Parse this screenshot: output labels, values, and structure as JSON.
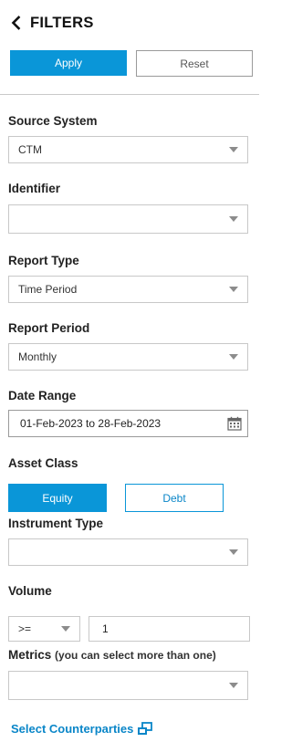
{
  "header": {
    "title": "FILTERS",
    "back_icon": "chevron-left-icon"
  },
  "actions": {
    "apply_label": "Apply",
    "reset_label": "Reset"
  },
  "fields": {
    "source_system": {
      "label": "Source System",
      "value": "CTM"
    },
    "identifier": {
      "label": "Identifier",
      "value": ""
    },
    "report_type": {
      "label": "Report Type",
      "value": "Time Period"
    },
    "report_period": {
      "label": "Report Period",
      "value": "Monthly"
    },
    "date_range": {
      "label": "Date Range",
      "value": "01-Feb-2023 to 28-Feb-2023",
      "icon": "calendar-icon"
    },
    "asset_class": {
      "label": "Asset Class",
      "options": [
        "Equity",
        "Debt"
      ],
      "selected": "Equity"
    },
    "instrument_type": {
      "label": "Instrument Type",
      "value": ""
    },
    "volume": {
      "label": "Volume",
      "operator": ">=",
      "value": "1"
    },
    "metrics": {
      "label": "Metrics",
      "hint": "(you can select more than one)",
      "value": ""
    }
  },
  "links": {
    "select_counterparties": "Select Counterparties",
    "icon": "external-window-icon"
  },
  "colors": {
    "accent": "#0a96d8",
    "link": "#0a86c8",
    "border": "#c8c8c8"
  }
}
